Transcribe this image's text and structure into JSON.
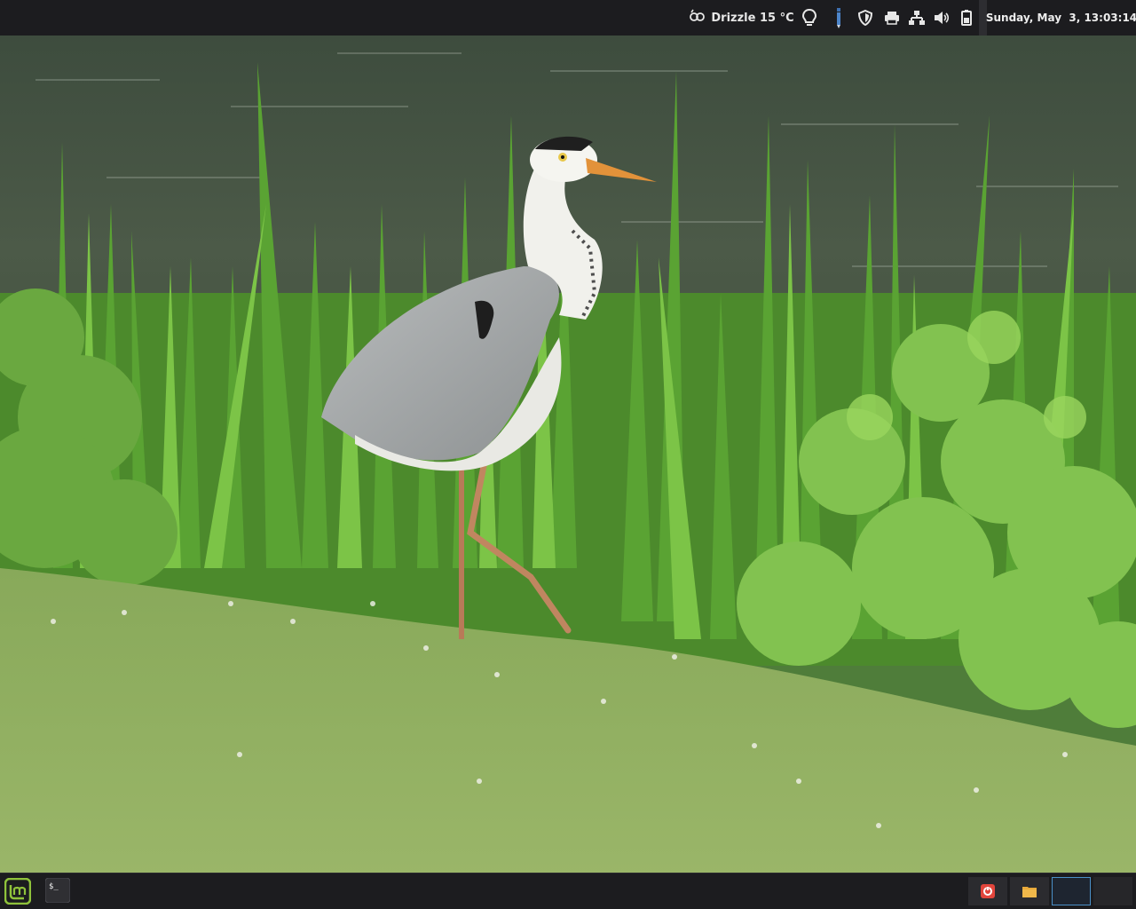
{
  "top_panel": {
    "weather": {
      "icon": "cloud-drizzle-icon",
      "text": "Drizzle 15 °C"
    },
    "indicators": [
      {
        "name": "lightbulb-icon"
      },
      {
        "name": "pen-icon"
      },
      {
        "name": "shield-icon"
      },
      {
        "name": "printer-icon"
      },
      {
        "name": "network-icon"
      },
      {
        "name": "volume-icon"
      },
      {
        "name": "battery-icon"
      }
    ],
    "clock": "Sunday, May  3, 13:03:14"
  },
  "bottom_panel": {
    "menu_icon": "mint-menu-icon",
    "launchers": [
      {
        "name": "terminal-icon",
        "label": "$_"
      }
    ],
    "tray": [
      {
        "name": "update-manager-icon"
      },
      {
        "name": "file-manager-icon"
      }
    ],
    "workspaces": {
      "count": 2,
      "active": 1
    }
  },
  "colors": {
    "panel_bg": "#1c1c1f",
    "panel_text": "#e6e6e6",
    "mint_green": "#8fc23b",
    "workspace_active_border": "#4a90c8",
    "update_red": "#e2453c",
    "folder_yellow": "#e8a93a"
  }
}
